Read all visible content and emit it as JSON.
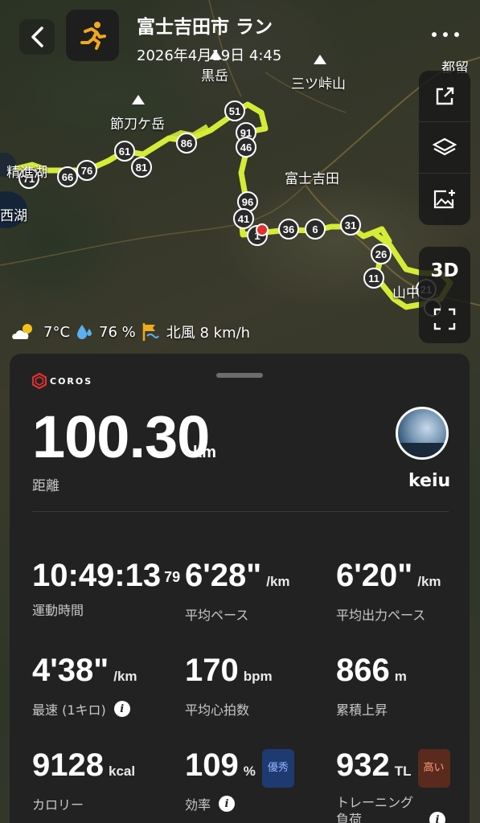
{
  "header": {
    "title": "富士吉田市 ラン",
    "datetime": "2026年4月19日 4:45"
  },
  "map": {
    "labels": {
      "kurodake": "黒岳",
      "mitsutoge": "三ツ峠山",
      "tsuru": "都留",
      "hakkadake": "節刀ケ岳",
      "shojiko": "精進湖",
      "nishiko": "西湖",
      "fujiyoshida": "富士吉田",
      "yamanaka": "山中"
    },
    "kilometer_markers": [
      "51",
      "91",
      "46",
      "86",
      "61",
      "81",
      "71",
      "66",
      "76",
      "96",
      "41",
      "1",
      "36",
      "6",
      "31",
      "26",
      "11",
      "21"
    ],
    "tool_3d_label": "3D",
    "route_color": "#d4ec36"
  },
  "weather": {
    "temperature": "7°C",
    "humidity": "76 %",
    "wind": "北風 8 km/h"
  },
  "panel": {
    "brand": "COROS",
    "distance": {
      "value": "100.30",
      "unit": "km",
      "label": "距離"
    },
    "user": {
      "name": "keiu"
    },
    "metrics": {
      "moving_time": {
        "value": "10:49:13",
        "sup": "79",
        "label": "運動時間"
      },
      "avg_pace": {
        "value": "6'28\"",
        "unit": "/km",
        "label": "平均ペース"
      },
      "avg_power_pace": {
        "value": "6'20\"",
        "unit": "/km",
        "label": "平均出力ペース"
      },
      "fastest": {
        "value": "4'38\"",
        "unit": "/km",
        "label": "最速 (1キロ)"
      },
      "avg_hr": {
        "value": "170",
        "unit": "bpm",
        "label": "平均心拍数"
      },
      "elevation": {
        "value": "866",
        "unit": "m",
        "label": "累積上昇"
      },
      "calories": {
        "value": "9128",
        "unit": "kcal",
        "label": "カロリー"
      },
      "efficiency": {
        "value": "109",
        "unit": "%",
        "badge": "優秀",
        "label": "効率"
      },
      "training_load": {
        "value": "932",
        "unit": "TL",
        "badge": "高い",
        "label": "トレーニング\n負荷"
      }
    }
  }
}
